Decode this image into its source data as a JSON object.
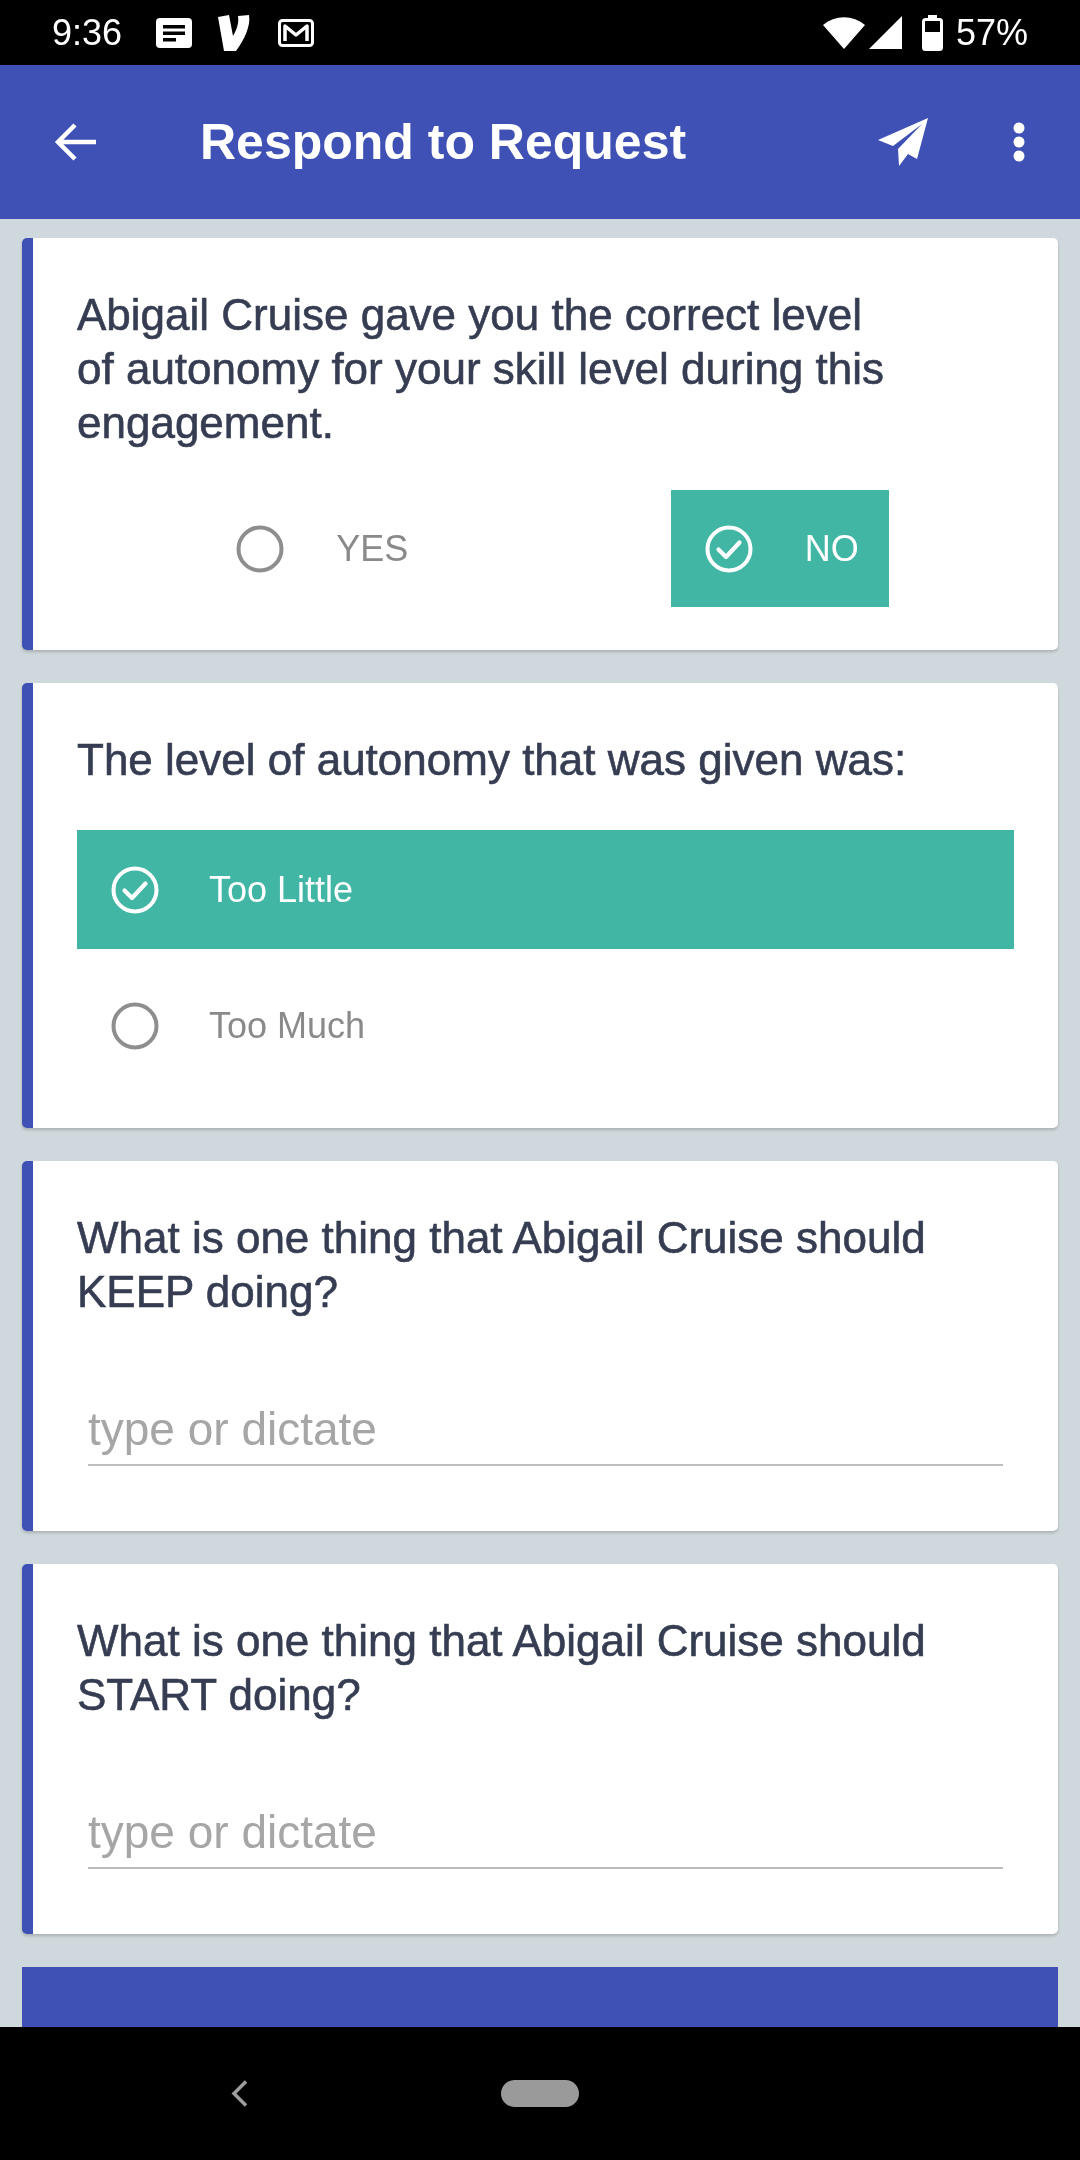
{
  "status_bar": {
    "time": "9:36",
    "battery": "57%"
  },
  "app_bar": {
    "title": "Respond to Request"
  },
  "questions": [
    {
      "kind": "yes_no",
      "prompt": "Abigail Cruise gave you the correct level of autonomy for your skill level during this engagement.",
      "options": [
        {
          "label": "YES",
          "selected": false
        },
        {
          "label": "NO",
          "selected": true
        }
      ]
    },
    {
      "kind": "choice_list",
      "prompt": "The level of autonomy that was given was:",
      "options": [
        {
          "label": "Too Little",
          "selected": true
        },
        {
          "label": "Too Much",
          "selected": false
        }
      ]
    },
    {
      "kind": "text",
      "prompt": "What is one thing that Abigail Cruise should KEEP doing?",
      "placeholder": "type or dictate"
    },
    {
      "kind": "text",
      "prompt": "What is one thing that Abigail Cruise should START doing?",
      "placeholder": "type or dictate"
    }
  ]
}
